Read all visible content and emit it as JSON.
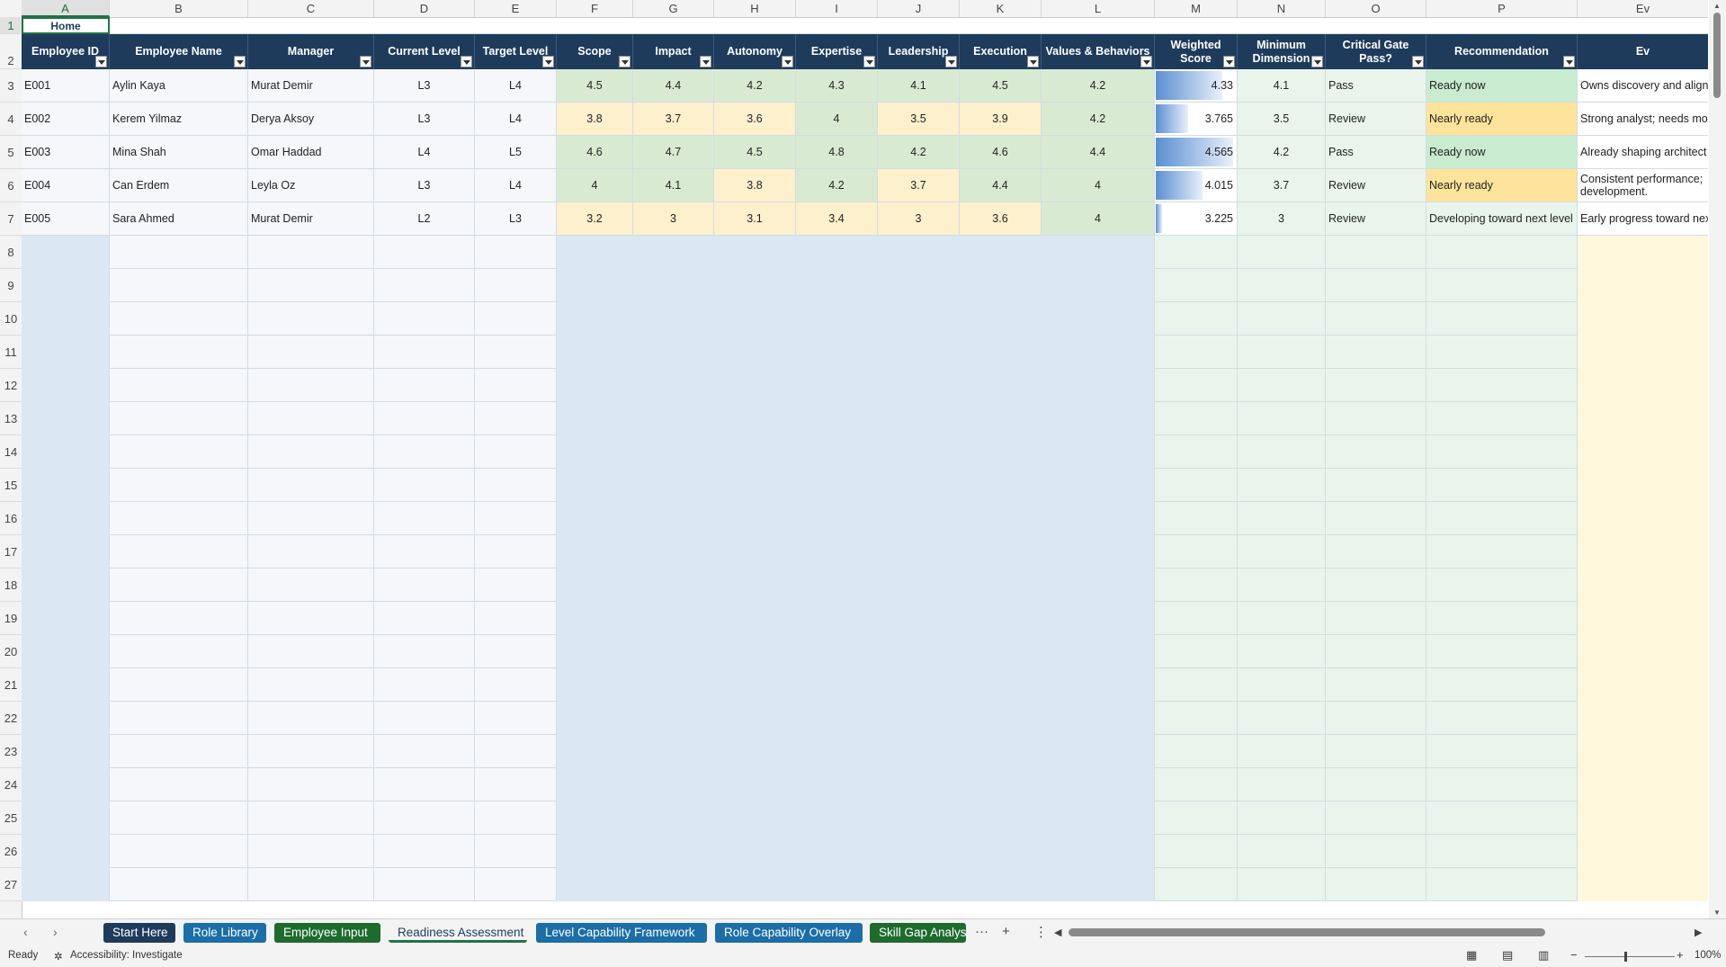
{
  "columns": [
    "A",
    "B",
    "C",
    "D",
    "E",
    "F",
    "G",
    "H",
    "I",
    "J",
    "K",
    "L",
    "M",
    "N",
    "O",
    "P",
    "Ev"
  ],
  "row_numbers": [
    "1",
    "2",
    "3",
    "4",
    "5",
    "6",
    "7",
    "8",
    "9",
    "10",
    "11",
    "12",
    "13",
    "14",
    "15",
    "16",
    "17",
    "18",
    "19",
    "20",
    "21",
    "22",
    "23",
    "24",
    "25",
    "26",
    "27"
  ],
  "home_label": "Home",
  "headers": [
    "Employee ID",
    "Employee Name",
    "Manager",
    "Current Level",
    "Target Level",
    "Scope",
    "Impact",
    "Autonomy",
    "Expertise",
    "Leadership",
    "Execution",
    "Values & Behaviors",
    "Weighted Score",
    "Minimum Dimension",
    "Critical Gate Pass?",
    "Recommendation",
    "Ev"
  ],
  "rows": [
    {
      "id": "E001",
      "name": "Aylin Kaya",
      "manager": "Murat Demir",
      "current": "L3",
      "target": "L4",
      "scores": [
        "4.5",
        "4.4",
        "4.2",
        "4.3",
        "4.1",
        "4.5",
        "4.2"
      ],
      "weighted": "4.33",
      "weighted_pct": 0.86,
      "minimum": "4.1",
      "gate": "Pass",
      "rec": "Ready now",
      "evidence": "Owns discovery and align"
    },
    {
      "id": "E002",
      "name": "Kerem Yilmaz",
      "manager": "Derya Aksoy",
      "current": "L3",
      "target": "L4",
      "scores": [
        "3.8",
        "3.7",
        "3.6",
        "4",
        "3.5",
        "3.9",
        "4.2"
      ],
      "weighted": "3.765",
      "weighted_pct": 0.42,
      "minimum": "3.5",
      "gate": "Review",
      "rec": "Nearly ready",
      "evidence": "Strong analyst; needs mo"
    },
    {
      "id": "E003",
      "name": "Mina Shah",
      "manager": "Omar Haddad",
      "current": "L4",
      "target": "L5",
      "scores": [
        "4.6",
        "4.7",
        "4.5",
        "4.8",
        "4.2",
        "4.6",
        "4.4"
      ],
      "weighted": "4.565",
      "weighted_pct": 1.0,
      "minimum": "4.2",
      "gate": "Pass",
      "rec": "Ready now",
      "evidence": "Already shaping architect"
    },
    {
      "id": "E004",
      "name": "Can Erdem",
      "manager": "Leyla Oz",
      "current": "L3",
      "target": "L4",
      "scores": [
        "4",
        "4.1",
        "3.8",
        "4.2",
        "3.7",
        "4.4",
        "4"
      ],
      "weighted": "4.015",
      "weighted_pct": 0.6,
      "minimum": "3.7",
      "gate": "Review",
      "rec": "Nearly ready",
      "evidence": "Consistent performance; development."
    },
    {
      "id": "E005",
      "name": "Sara Ahmed",
      "manager": "Murat Demir",
      "current": "L2",
      "target": "L3",
      "scores": [
        "3.2",
        "3",
        "3.1",
        "3.4",
        "3",
        "3.6",
        "4"
      ],
      "weighted": "3.225",
      "weighted_pct": 0.08,
      "minimum": "3",
      "gate": "Review",
      "rec": "Developing toward next level",
      "evidence": "Early progress toward nex"
    }
  ],
  "score_colors": {
    "high": "#d9ead3",
    "mid": "#fdf0cc"
  },
  "tabs": [
    {
      "label": "Start Here",
      "color": "#1f3b5c"
    },
    {
      "label": "Role Library",
      "color": "#1b6ea8"
    },
    {
      "label": "Employee Input",
      "color": "#1e6b2e"
    },
    {
      "label": "Readiness Assessment",
      "color": "active"
    },
    {
      "label": "Level Capability Framework",
      "color": "#1b6ea8"
    },
    {
      "label": "Role Capability Overlay",
      "color": "#1b6ea8"
    },
    {
      "label": "Skill Gap Analys",
      "color": "#1e6b2e"
    }
  ],
  "status": {
    "ready": "Ready",
    "accessibility": "Accessibility: Investigate",
    "zoom": "100%"
  }
}
